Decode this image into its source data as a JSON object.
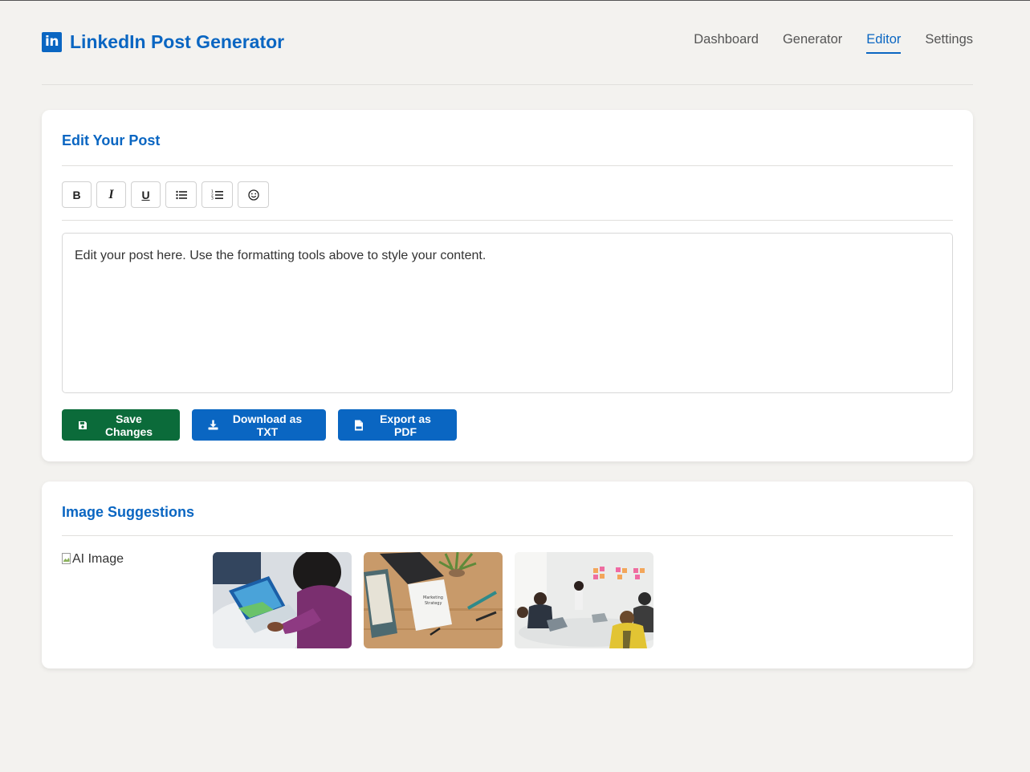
{
  "app": {
    "logo_text": "in",
    "title": "LinkedIn Post Generator",
    "brand_color": "#0a66c2"
  },
  "nav": {
    "items": [
      {
        "label": "Dashboard",
        "active": false
      },
      {
        "label": "Generator",
        "active": false
      },
      {
        "label": "Editor",
        "active": true
      },
      {
        "label": "Settings",
        "active": false
      }
    ]
  },
  "editor_card": {
    "title": "Edit Your Post",
    "toolbar": [
      {
        "label": "B",
        "icon": "bold-icon"
      },
      {
        "label": "I",
        "icon": "italic-icon"
      },
      {
        "label": "U",
        "icon": "underline-icon"
      },
      {
        "icon": "bullet-list-icon"
      },
      {
        "icon": "numbered-list-icon"
      },
      {
        "icon": "emoji-icon"
      }
    ],
    "content": "Edit your post here. Use the formatting tools above to style your content.",
    "actions": {
      "save": {
        "label": "Save Changes",
        "icon": "save-icon",
        "color": "#0b6b3a"
      },
      "download": {
        "label": "Download as TXT",
        "icon": "download-icon",
        "color": "#0a66c2"
      },
      "export": {
        "label": "Export as PDF",
        "icon": "pdf-file-icon",
        "color": "#0a66c2"
      }
    }
  },
  "images_card": {
    "title": "Image Suggestions",
    "broken_image_alt": "AI Image",
    "thumbnails": [
      {
        "icon": "photo-laptop-person"
      },
      {
        "icon": "photo-desk-marketing-strategy"
      },
      {
        "icon": "photo-team-meeting-sticky-notes"
      }
    ]
  }
}
